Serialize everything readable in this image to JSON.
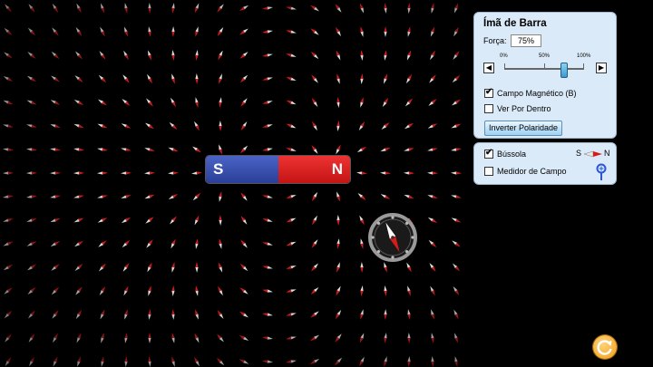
{
  "bar_panel": {
    "title": "Ímã de Barra",
    "strength_label": "Força:",
    "strength_value": "75%",
    "strength_fraction": 0.75,
    "slider_ticks": [
      "0%",
      "50%",
      "100%"
    ],
    "checkbox_field": "Campo Magnético (B)",
    "checkbox_field_checked": true,
    "checkbox_inside": "Ver Por Dentro",
    "checkbox_inside_checked": false,
    "button_invert": "Inverter Polaridade"
  },
  "tools_panel": {
    "compass_label": "Bússola",
    "compass_checked": true,
    "compass_icon_s": "S",
    "compass_icon_n": "N",
    "meter_label": "Medidor de Campo",
    "meter_checked": false
  },
  "magnet": {
    "south": "S",
    "north": "N"
  },
  "colors": {
    "north": "#d81c1c",
    "south": "#3347a8",
    "panel": "#dbeaf8",
    "background": "#000000"
  },
  "icons": {
    "left-arrow": "◀",
    "right-arrow": "▶",
    "check": "✔",
    "compass-tool": "compass-needle-icon",
    "meter-tool": "probe-icon",
    "reset": "reset-icon"
  }
}
